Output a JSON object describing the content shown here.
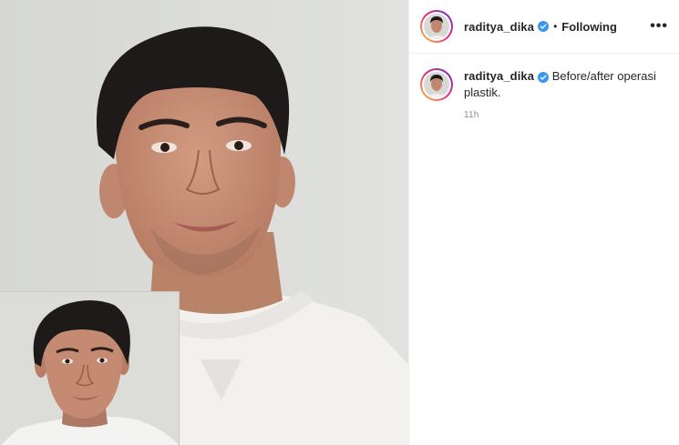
{
  "post": {
    "username": "raditya_dika",
    "follow_status": "Following",
    "separator": "•",
    "more_label": "•••",
    "caption": "Before/after operasi plastik.",
    "time": "11h",
    "verified_color": "#3897f0"
  },
  "media": {
    "description_icons": [
      "portrait-photo",
      "portrait-inset-photo"
    ]
  }
}
